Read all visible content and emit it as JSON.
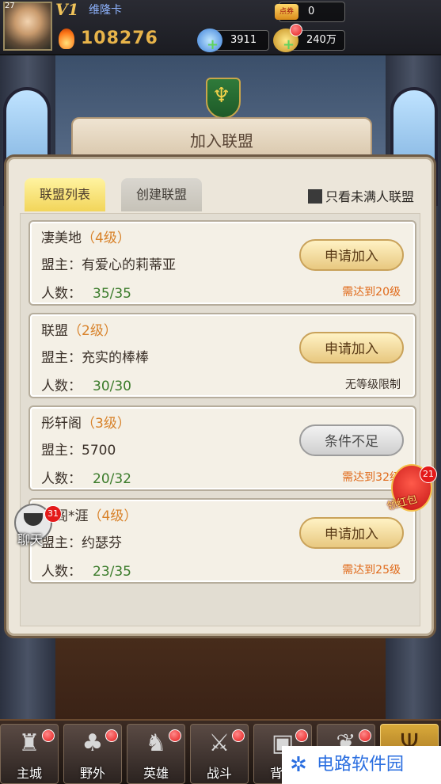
{
  "topbar": {
    "level": "27",
    "vip": "V1",
    "player_name": "维隆卡",
    "power": "108276",
    "points_icon": "点券",
    "points": "0",
    "diamonds": "3911",
    "gold": "240万"
  },
  "title": "加入联盟",
  "tabs": [
    {
      "label": "联盟列表",
      "active": true
    },
    {
      "label": "创建联盟",
      "active": false
    }
  ],
  "filter": {
    "label": "只看未满人联盟",
    "checked": true
  },
  "alliances": [
    {
      "name": "凄美地",
      "level": "（4级）",
      "leader_label": "盟主：",
      "leader": "有爱心的莉蒂亚",
      "members_label": "人数：",
      "members": "35/35",
      "button": "申请加入",
      "requirement": "需达到20级"
    },
    {
      "name": "联盟",
      "level": "（2级）",
      "leader_label": "盟主：",
      "leader": "充实的棒棒",
      "members_label": "人数：",
      "members": "30/30",
      "button": "申请加入",
      "requirement": "无等级限制"
    },
    {
      "name": "彤轩阁",
      "level": "（3级）",
      "leader_label": "盟主：",
      "leader": "5700",
      "members_label": "人数：",
      "members": "20/32",
      "button": "条件不足",
      "requirement": "需达到32级"
    },
    {
      "name": "高阁*涯",
      "level": "（4级）",
      "leader_label": "盟主：",
      "leader": "约瑟芬",
      "members_label": "人数：",
      "members": "23/35",
      "button": "申请加入",
      "requirement": "需达到25级"
    }
  ],
  "chat": {
    "label": "聊天",
    "badge": "31"
  },
  "hongbao": {
    "label": "领红包",
    "badge": "21"
  },
  "nav": [
    {
      "label": "主城",
      "icon": "castle-icon"
    },
    {
      "label": "野外",
      "icon": "tree-icon"
    },
    {
      "label": "英雄",
      "icon": "helmet-icon"
    },
    {
      "label": "战斗",
      "icon": "sword-icon"
    },
    {
      "label": "背包",
      "icon": "bag-icon"
    },
    {
      "label": "",
      "icon": "wings-icon"
    },
    {
      "label": "",
      "icon": "trident-icon"
    }
  ],
  "watermark": "电路软件园",
  "colors": {
    "level_text": "#d8822a",
    "members_value": "#3a7b2a",
    "requirement": "#e06a1a",
    "active_tab": "#f2d55a"
  }
}
